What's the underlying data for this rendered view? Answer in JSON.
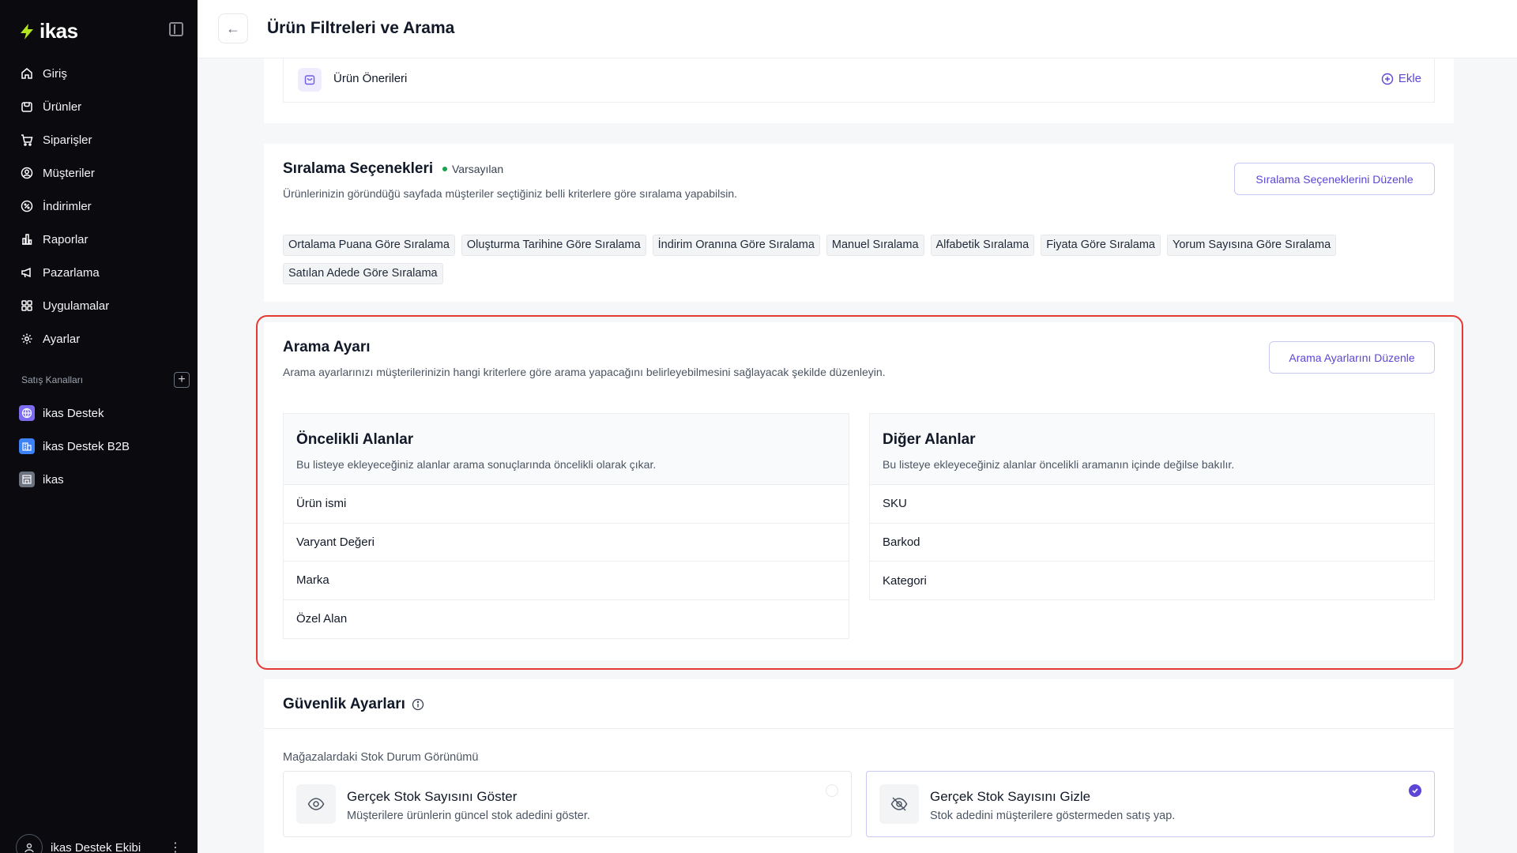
{
  "app": {
    "logo_text": "ikas"
  },
  "sidebar": {
    "items": [
      {
        "label": "Giriş",
        "icon": "home-icon"
      },
      {
        "label": "Ürünler",
        "icon": "box-icon"
      },
      {
        "label": "Siparişler",
        "icon": "cart-icon"
      },
      {
        "label": "Müşteriler",
        "icon": "user-icon"
      },
      {
        "label": "İndirimler",
        "icon": "discount-icon"
      },
      {
        "label": "Raporlar",
        "icon": "chart-icon"
      },
      {
        "label": "Pazarlama",
        "icon": "megaphone-icon"
      },
      {
        "label": "Uygulamalar",
        "icon": "apps-icon"
      },
      {
        "label": "Ayarlar",
        "icon": "gear-icon"
      }
    ],
    "channels_label": "Satış Kanalları",
    "channels": [
      {
        "label": "ikas Destek",
        "icon": "globe-icon"
      },
      {
        "label": "ikas Destek B2B",
        "icon": "building-icon"
      },
      {
        "label": "ikas",
        "icon": "store-icon"
      }
    ],
    "user_name": "ikas Destek Ekibi"
  },
  "header": {
    "title": "Ürün Filtreleri ve Arama"
  },
  "suggestions": {
    "label": "Ürün Önerileri",
    "add_label": "Ekle"
  },
  "sorting": {
    "title": "Sıralama Seçenekleri",
    "badge": "Varsayılan",
    "subtitle": "Ürünlerinizin göründüğü sayfada müşteriler seçtiğiniz belli kriterlere göre sıralama yapabilsin.",
    "edit_button": "Sıralama Seçeneklerini Düzenle",
    "options": [
      "Ortalama Puana Göre Sıralama",
      "Oluşturma Tarihine Göre Sıralama",
      "İndirim Oranına Göre Sıralama",
      "Manuel Sıralama",
      "Alfabetik Sıralama",
      "Fiyata Göre Sıralama",
      "Yorum Sayısına Göre Sıralama",
      "Satılan Adede Göre Sıralama"
    ]
  },
  "search": {
    "title": "Arama Ayarı",
    "subtitle": "Arama ayarlarınızı müşterilerinizin hangi kriterlere göre arama yapacağını belirleyebilmesini sağlayacak şekilde düzenleyin.",
    "edit_button": "Arama Ayarlarını Düzenle",
    "priority": {
      "title": "Öncelikli Alanlar",
      "subtitle": "Bu listeye ekleyeceğiniz alanlar arama sonuçlarında öncelikli olarak çıkar.",
      "fields": [
        "Ürün ismi",
        "Varyant Değeri",
        "Marka",
        "Özel Alan"
      ]
    },
    "other": {
      "title": "Diğer Alanlar",
      "subtitle": "Bu listeye ekleyeceğiniz alanlar öncelikli aramanın içinde değilse bakılır.",
      "fields": [
        "SKU",
        "Barkod",
        "Kategori"
      ]
    }
  },
  "security": {
    "title": "Güvenlik Ayarları",
    "stock_label": "Mağazalardaki Stok Durum Görünümü",
    "options": [
      {
        "title": "Gerçek Stok Sayısını Göster",
        "desc": "Müşterilere ürünlerin güncel stok adedini göster.",
        "icon": "eye-icon",
        "selected": false
      },
      {
        "title": "Gerçek Stok Sayısını Gizle",
        "desc": "Stok adedini müşterilere göstermeden satış yap.",
        "icon": "eye-off-icon",
        "selected": true
      }
    ]
  },
  "colors": {
    "accent": "#5b46d6",
    "highlight": "#e53935",
    "sidebar": "#0b0b0f",
    "success": "#16a34a"
  }
}
